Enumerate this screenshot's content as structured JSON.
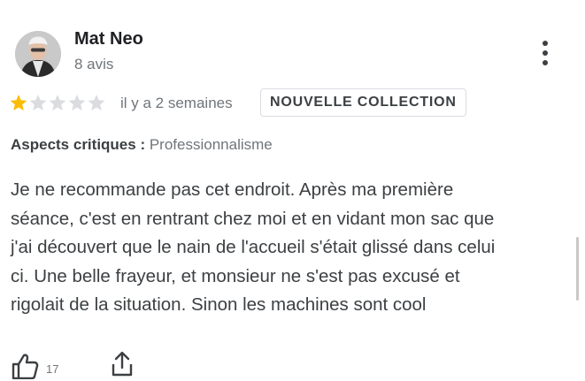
{
  "review": {
    "author": {
      "name": "Mat Neo",
      "meta": "8 avis",
      "avatar_icon": "user-photo-icon"
    },
    "menu_icon": "more-vert-icon",
    "rating": {
      "value": 1,
      "max": 5,
      "filled_color": "#fbbc04",
      "empty_color": "#dadce0"
    },
    "time_ago": "il y a 2 semaines",
    "badge": "NOUVELLE COLLECTION",
    "aspects": {
      "label": "Aspects critiques :",
      "value": "Professionnalisme"
    },
    "text_lines": [
      "Je ne recommande pas cet endroit. Après ma première",
      "séance, c'est en rentrant chez moi et en vidant mon sac que",
      "j'ai découvert que le nain de l'accueil s'était glissé dans celui",
      "ci. Une belle frayeur, et monsieur ne s'est pas excusé et",
      "rigolait de la situation. Sinon les machines sont cool"
    ],
    "actions": {
      "like_icon": "thumb-up-icon",
      "like_count": "17",
      "share_icon": "share-icon"
    }
  }
}
